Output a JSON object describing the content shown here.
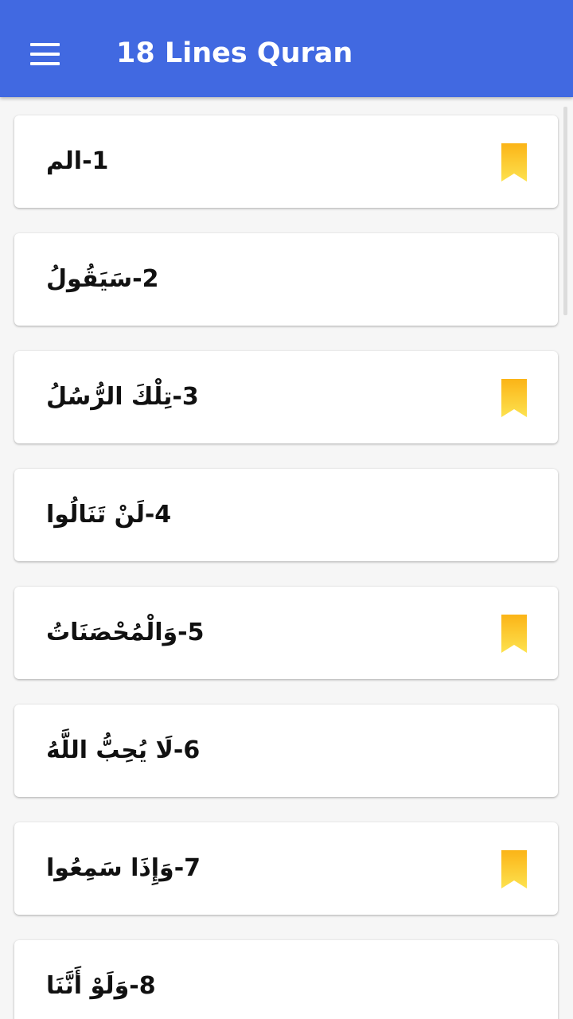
{
  "app": {
    "title": "18 Lines Quran",
    "menu_icon": "hamburger-menu-icon",
    "bar_color": "#4169e1"
  },
  "bookmark_color": "#fcc419",
  "list": {
    "items": [
      {
        "label": "1-الم",
        "bookmarked": true
      },
      {
        "label": "2-سَيَقُولُ",
        "bookmarked": false
      },
      {
        "label": "3-تِلْكَ الرُّسُلُ",
        "bookmarked": true
      },
      {
        "label": "4-لَنْ تَنَالُوا",
        "bookmarked": false
      },
      {
        "label": "5-وَالْمُحْصَنَاتُ",
        "bookmarked": true
      },
      {
        "label": "6-لَا يُحِبُّ اللَّهُ",
        "bookmarked": false
      },
      {
        "label": "7-وَإِذَا سَمِعُوا",
        "bookmarked": true
      },
      {
        "label": "8-وَلَوْ أَنَّنَا",
        "bookmarked": false
      }
    ]
  }
}
